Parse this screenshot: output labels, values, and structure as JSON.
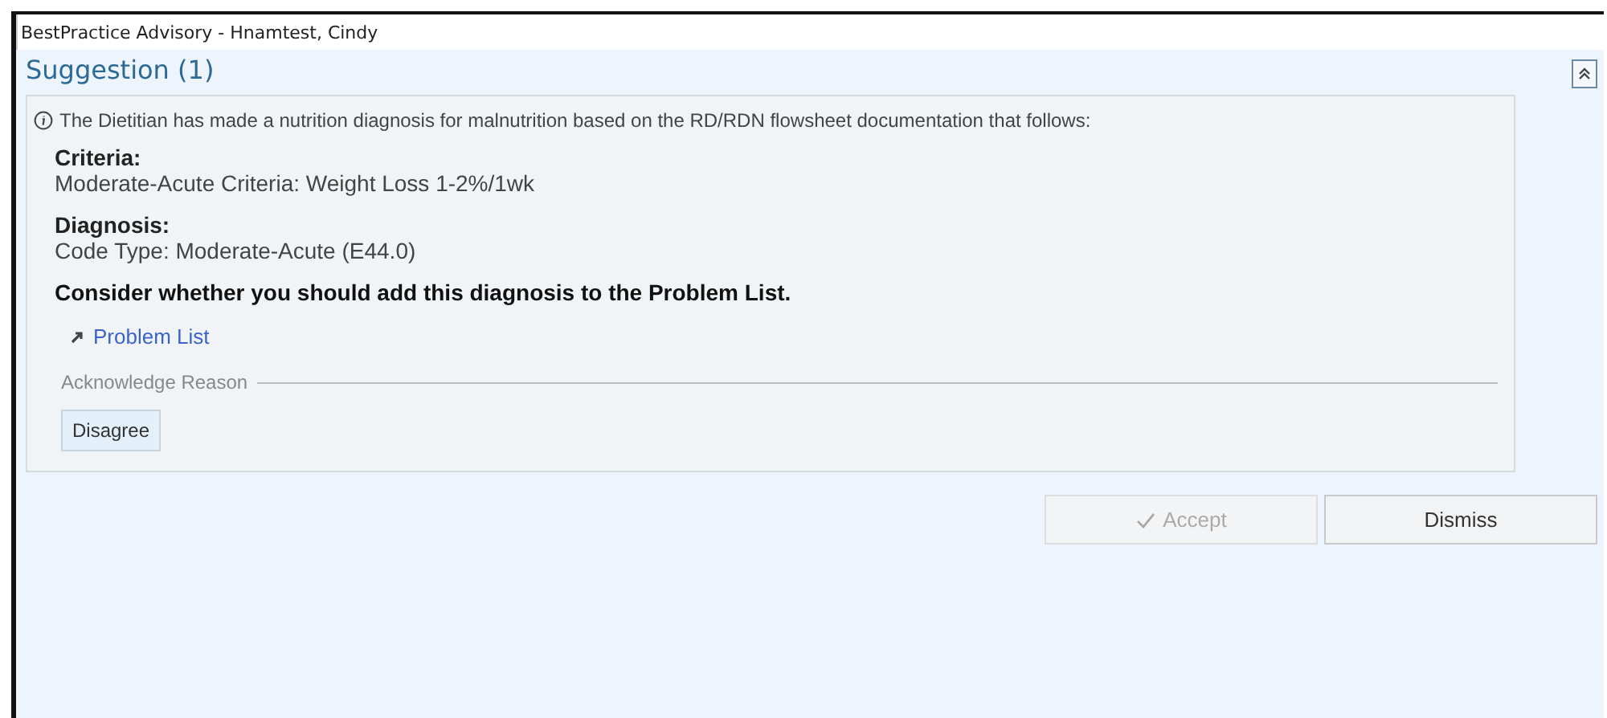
{
  "window": {
    "title": "BestPractice Advisory - Hnamtest, Cindy"
  },
  "section": {
    "title": "Suggestion (1)",
    "expanded": true
  },
  "advisory": {
    "message": "The Dietitian has made a nutrition diagnosis for malnutrition based on the RD/RDN flowsheet documentation that follows:",
    "blocks": [
      {
        "heading": "Criteria:",
        "text": "Moderate-Acute Criteria: Weight Loss 1-2%/1wk"
      },
      {
        "heading": "Diagnosis:",
        "text": "Code Type: Moderate-Acute (E44.0)"
      }
    ],
    "prompt": "Consider whether you should add this diagnosis to the Problem List.",
    "link": "Problem List",
    "acknowledge": {
      "label": "Acknowledge Reason",
      "options": [
        {
          "label": "Disagree",
          "selected": false
        }
      ]
    }
  },
  "buttons": [
    {
      "label": "Accept",
      "kind": "accept",
      "disabled": true
    },
    {
      "label": "Dismiss",
      "kind": "plain",
      "disabled": false
    }
  ]
}
